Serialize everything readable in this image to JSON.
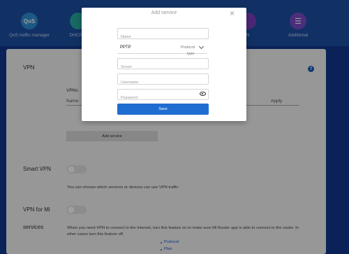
{
  "nav": {
    "items": [
      {
        "label": "QoS traffic manager",
        "icon_text": "QoS",
        "icon": "qos-icon",
        "color": "#2f8fd6"
      },
      {
        "label": "DHCP st",
        "icon_text": "",
        "icon": "dhcp-icon",
        "color": "#27a8a0"
      },
      {
        "label": "N",
        "icon_text": "",
        "icon": "network-icon",
        "color": "#7b3fc1"
      },
      {
        "label": "Additional",
        "icon_text": "☰",
        "icon": "menu-icon",
        "color": "#7a4bc9"
      }
    ]
  },
  "vpn": {
    "section_label": "VPN",
    "help_icon_text": "?",
    "vpns_title": "VPNs",
    "columns": [
      "Name",
      "Apply"
    ],
    "add_service_label": "Add service"
  },
  "smart_vpn": {
    "label": "Smart VPN",
    "description": "You can choose which services or devices can use VPN traffic",
    "enabled": false
  },
  "vpn_for_mi": {
    "label_line1": "VPN for Mi",
    "label_line2": "services",
    "description_line1": "When you need VPN to connect to the Internet, turn this feature on to make sure Mi Router app is able to connect to the router. In",
    "description_line2": "other cases turn this feature off.",
    "enabled": false,
    "links": [
      "Protocol",
      "Plan"
    ]
  },
  "modal": {
    "title": "Add service",
    "close_icon_text": "×",
    "name_placeholder": "Name",
    "protocol_value": "PPTP",
    "protocol_label_line1": "Protocol",
    "protocol_label_line2": "type",
    "server_placeholder": "Server",
    "username_placeholder": "Username",
    "password_placeholder": "Password",
    "save_label": "Save",
    "accent_color": "#1f6dd1"
  }
}
